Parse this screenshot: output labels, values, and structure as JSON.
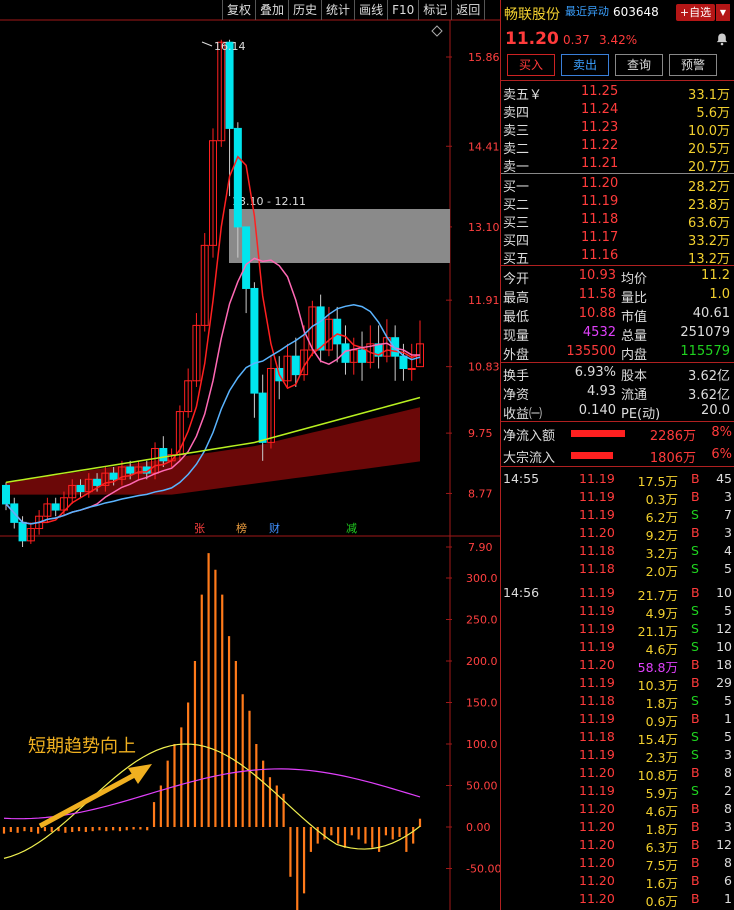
{
  "toolbar": [
    "复权",
    "叠加",
    "历史",
    "统计",
    "画线",
    "F10",
    "标记",
    "返回"
  ],
  "chart": {
    "price_axis": [
      "15.86",
      "14.41",
      "13.10",
      "11.91",
      "10.83",
      "9.75",
      "8.77",
      "7.90"
    ],
    "volume_axis": [
      "300.0",
      "250.0",
      "200.0",
      "150.0",
      "100.0",
      "50.00",
      "0.00",
      "-50.00"
    ],
    "high_label": "16.14",
    "range_label": "13.10 - 12.11",
    "markers": [
      {
        "text": "张",
        "color": "#ff4040"
      },
      {
        "text": "榜",
        "color": "#f0a040"
      },
      {
        "text": "财",
        "color": "#4090ff"
      },
      {
        "text": "减",
        "color": "#20d020"
      }
    ],
    "annotation": "短期趋势向上",
    "colors": {
      "up": "#ff2020",
      "down": "#00e5ee",
      "ma_red": "#ff2020",
      "ma_pink": "#ff69b4",
      "ma_blue": "#5ab4ff",
      "ma_yellow": "#b8f020",
      "band": "#6b0808",
      "volume": "#ff7a1a"
    }
  },
  "stock": {
    "name": "畅联股份",
    "tag": "最近异动",
    "code": "603648",
    "fav_label": "+自选",
    "price": "11.20",
    "change": "0.37",
    "pct": "3.42%"
  },
  "buttons": {
    "buy": "买入",
    "sell": "卖出",
    "query": "查询",
    "alert": "预警"
  },
  "asks": [
    {
      "label": "卖五￥",
      "price": "11.25",
      "vol": "33.1万"
    },
    {
      "label": "卖四",
      "price": "11.24",
      "vol": "5.6万"
    },
    {
      "label": "卖三",
      "price": "11.23",
      "vol": "10.0万"
    },
    {
      "label": "卖二",
      "price": "11.22",
      "vol": "20.5万"
    },
    {
      "label": "卖一",
      "price": "11.21",
      "vol": "20.7万"
    }
  ],
  "bids": [
    {
      "label": "买一",
      "price": "11.20",
      "vol": "28.2万"
    },
    {
      "label": "买二",
      "price": "11.19",
      "vol": "23.8万"
    },
    {
      "label": "买三",
      "price": "11.18",
      "vol": "63.6万"
    },
    {
      "label": "买四",
      "price": "11.17",
      "vol": "33.2万"
    },
    {
      "label": "买五",
      "price": "11.16",
      "vol": "13.2万"
    }
  ],
  "stats1": [
    {
      "l1": "今开",
      "v1": "10.93",
      "c1": "red",
      "l2": "均价",
      "v2": "11.2",
      "c2": "yellow"
    },
    {
      "l1": "最高",
      "v1": "11.58",
      "c1": "red",
      "l2": "量比",
      "v2": "1.0",
      "c2": "yellow"
    },
    {
      "l1": "最低",
      "v1": "10.88",
      "c1": "red",
      "l2": "市值",
      "v2": "40.61",
      "c2": ""
    },
    {
      "l1": "现量",
      "v1": "4532",
      "c1": "purple",
      "l2": "总量",
      "v2": "251079",
      "c2": ""
    },
    {
      "l1": "外盘",
      "v1": "135500",
      "c1": "red",
      "l2": "内盘",
      "v2": "115579",
      "c2": "green"
    }
  ],
  "stats2": [
    {
      "l1": "换手",
      "v1": "6.93%",
      "c1": "",
      "l2": "股本",
      "v2": "3.62亿",
      "c2": ""
    },
    {
      "l1": "净资",
      "v1": "4.93",
      "c1": "",
      "l2": "流通",
      "v2": "3.62亿",
      "c2": ""
    },
    {
      "l1": "收益㈠",
      "v1": "0.140",
      "c1": "",
      "l2": "PE(动)",
      "v2": "20.0",
      "c2": ""
    }
  ],
  "flows": [
    {
      "label": "净流入额",
      "value": "2286万",
      "pct": "8%",
      "bar": 0.77
    },
    {
      "label": "大宗流入",
      "value": "1806万",
      "pct": "6%",
      "bar": 0.6
    }
  ],
  "ticks": [
    {
      "time": "14:55",
      "price": "11.19",
      "vol": "17.5万",
      "dir": "B",
      "num": "45"
    },
    {
      "time": "",
      "price": "11.19",
      "vol": "0.3万",
      "dir": "B",
      "num": "3"
    },
    {
      "time": "",
      "price": "11.19",
      "vol": "6.2万",
      "dir": "S",
      "num": "7"
    },
    {
      "time": "",
      "price": "11.20",
      "vol": "9.2万",
      "dir": "B",
      "num": "3"
    },
    {
      "time": "",
      "price": "11.18",
      "vol": "3.2万",
      "dir": "S",
      "num": "4"
    },
    {
      "time": "",
      "price": "11.18",
      "vol": "2.0万",
      "dir": "S",
      "num": "5"
    },
    {
      "time": "14:56",
      "price": "11.19",
      "vol": "21.7万",
      "dir": "B",
      "num": "10"
    },
    {
      "time": "",
      "price": "11.19",
      "vol": "4.9万",
      "dir": "S",
      "num": "5"
    },
    {
      "time": "",
      "price": "11.19",
      "vol": "21.1万",
      "dir": "S",
      "num": "12"
    },
    {
      "time": "",
      "price": "11.19",
      "vol": "4.6万",
      "dir": "S",
      "num": "10"
    },
    {
      "time": "",
      "price": "11.20",
      "vol": "58.8万",
      "dir": "B",
      "num": "18"
    },
    {
      "time": "",
      "price": "11.19",
      "vol": "10.3万",
      "dir": "B",
      "num": "29"
    },
    {
      "time": "",
      "price": "11.18",
      "vol": "1.8万",
      "dir": "S",
      "num": "5"
    },
    {
      "time": "",
      "price": "11.19",
      "vol": "0.9万",
      "dir": "B",
      "num": "1"
    },
    {
      "time": "",
      "price": "11.18",
      "vol": "15.4万",
      "dir": "S",
      "num": "5"
    },
    {
      "time": "",
      "price": "11.19",
      "vol": "2.3万",
      "dir": "S",
      "num": "3"
    },
    {
      "time": "",
      "price": "11.20",
      "vol": "10.8万",
      "dir": "B",
      "num": "8"
    },
    {
      "time": "",
      "price": "11.19",
      "vol": "5.9万",
      "dir": "S",
      "num": "2"
    },
    {
      "time": "",
      "price": "11.20",
      "vol": "4.6万",
      "dir": "B",
      "num": "8"
    },
    {
      "time": "",
      "price": "11.20",
      "vol": "1.8万",
      "dir": "B",
      "num": "3"
    },
    {
      "time": "",
      "price": "11.20",
      "vol": "6.3万",
      "dir": "B",
      "num": "12"
    },
    {
      "time": "",
      "price": "11.20",
      "vol": "7.5万",
      "dir": "B",
      "num": "8"
    },
    {
      "time": "",
      "price": "11.20",
      "vol": "1.6万",
      "dir": "B",
      "num": "6"
    },
    {
      "time": "",
      "price": "11.20",
      "vol": "0.6万",
      "dir": "B",
      "num": "1"
    }
  ],
  "chart_data": {
    "type": "candlestick",
    "ylim": [
      7.9,
      15.86
    ],
    "candles": [
      [
        8.9,
        8.6,
        8.95,
        8.5
      ],
      [
        8.6,
        8.3,
        8.7,
        8.2
      ],
      [
        8.3,
        8.0,
        8.4,
        7.9
      ],
      [
        8.0,
        8.2,
        8.3,
        7.95
      ],
      [
        8.2,
        8.4,
        8.5,
        8.1
      ],
      [
        8.4,
        8.6,
        8.7,
        8.3
      ],
      [
        8.6,
        8.5,
        8.7,
        8.4
      ],
      [
        8.5,
        8.7,
        8.8,
        8.4
      ],
      [
        8.7,
        8.9,
        9.0,
        8.6
      ],
      [
        8.9,
        8.8,
        9.0,
        8.7
      ],
      [
        8.8,
        9.0,
        9.1,
        8.7
      ],
      [
        9.0,
        8.9,
        9.1,
        8.8
      ],
      [
        8.9,
        9.1,
        9.2,
        8.8
      ],
      [
        9.1,
        9.0,
        9.2,
        8.9
      ],
      [
        9.0,
        9.2,
        9.3,
        8.9
      ],
      [
        9.2,
        9.1,
        9.3,
        9.0
      ],
      [
        9.1,
        9.2,
        9.3,
        9.0
      ],
      [
        9.2,
        9.1,
        9.3,
        9.0
      ],
      [
        9.1,
        9.5,
        9.6,
        9.0
      ],
      [
        9.5,
        9.3,
        9.7,
        9.2
      ],
      [
        9.3,
        9.4,
        9.5,
        9.2
      ],
      [
        9.4,
        10.1,
        10.2,
        9.3
      ],
      [
        10.1,
        10.6,
        10.8,
        10.0
      ],
      [
        10.6,
        11.5,
        11.7,
        10.5
      ],
      [
        11.5,
        12.8,
        13.0,
        11.4
      ],
      [
        12.8,
        14.5,
        14.7,
        12.6
      ],
      [
        14.5,
        16.1,
        16.14,
        14.4
      ],
      [
        16.1,
        14.7,
        16.14,
        13.6
      ],
      [
        14.7,
        13.1,
        14.8,
        12.6
      ],
      [
        13.1,
        12.1,
        13.1,
        11.7
      ],
      [
        12.1,
        10.4,
        12.2,
        10.0
      ],
      [
        10.4,
        9.6,
        10.7,
        9.3
      ],
      [
        9.6,
        10.8,
        11.0,
        9.5
      ],
      [
        10.8,
        10.6,
        11.0,
        10.3
      ],
      [
        10.6,
        11.0,
        11.2,
        10.5
      ],
      [
        11.0,
        10.7,
        11.3,
        10.5
      ],
      [
        10.7,
        11.1,
        11.5,
        10.6
      ],
      [
        11.1,
        11.8,
        11.9,
        11.0
      ],
      [
        11.8,
        11.1,
        12.0,
        10.9
      ],
      [
        11.1,
        11.6,
        11.8,
        11.0
      ],
      [
        11.6,
        11.2,
        11.8,
        10.9
      ],
      [
        11.2,
        10.9,
        11.5,
        10.7
      ],
      [
        10.9,
        11.1,
        11.3,
        10.7
      ],
      [
        11.1,
        10.9,
        11.4,
        10.6
      ],
      [
        10.9,
        11.2,
        11.5,
        10.8
      ],
      [
        11.2,
        11.0,
        11.5,
        10.8
      ],
      [
        11.0,
        11.3,
        11.6,
        10.9
      ],
      [
        11.3,
        11.0,
        11.5,
        10.6
      ],
      [
        11.0,
        10.8,
        11.2,
        10.6
      ],
      [
        10.8,
        10.8,
        11.2,
        10.6
      ],
      [
        10.83,
        11.2,
        11.58,
        10.88
      ]
    ],
    "volumes": [
      -8,
      -6,
      -7,
      -5,
      -6,
      -8,
      -5,
      -6,
      -5,
      -7,
      -6,
      -5,
      -6,
      -5,
      -4,
      -5,
      -4,
      -5,
      -4,
      -3,
      -3,
      -4,
      30,
      50,
      80,
      100,
      120,
      150,
      200,
      280,
      330,
      310,
      280,
      230,
      200,
      160,
      140,
      100,
      80,
      60,
      50,
      40,
      -60,
      -100,
      -80,
      -30,
      -20,
      -15,
      -10,
      -20,
      -25,
      -10,
      -15,
      -20,
      -25,
      -30,
      -10,
      -15,
      -12,
      -30,
      -20,
      10
    ]
  }
}
